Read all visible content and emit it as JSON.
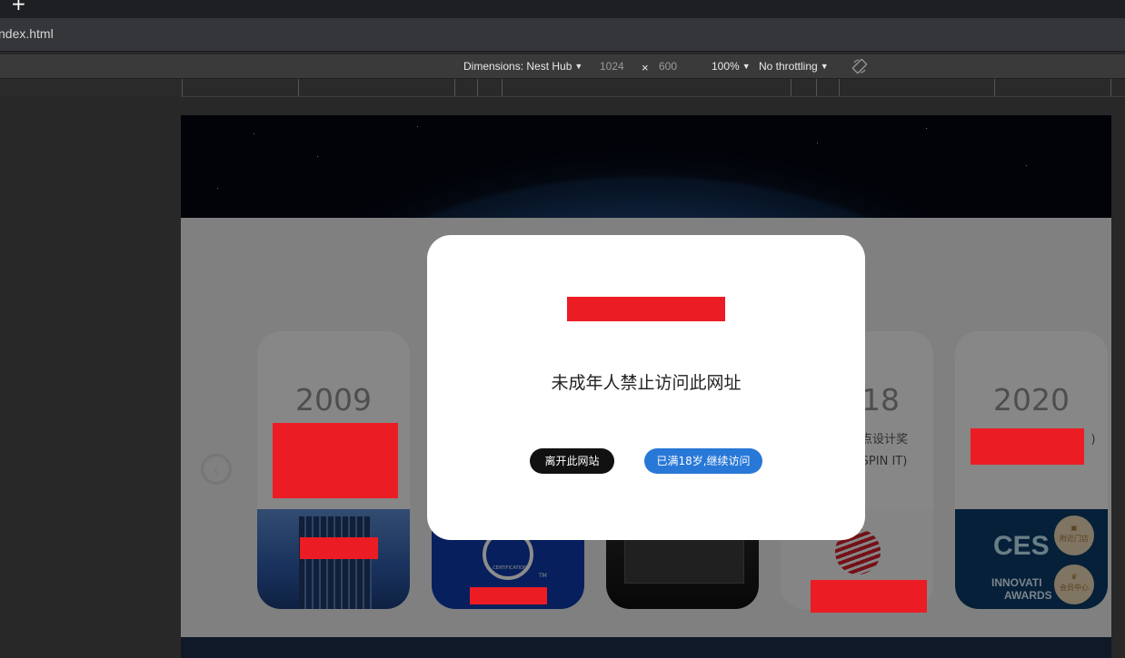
{
  "browser": {
    "new_tab_symbol": "+",
    "tab_title": "ndex.html"
  },
  "devtools": {
    "dimensions_label": "Dimensions: Nest Hub",
    "width": "1024",
    "times": "×",
    "height": "600",
    "zoom": "100%",
    "throttling": "No throttling",
    "rotate_icon": "rotate-icon"
  },
  "page": {
    "cards": [
      {
        "year": "2009",
        "text": ""
      },
      {
        "year": "",
        "text": ""
      },
      {
        "year": "",
        "text": ""
      },
      {
        "year": "18",
        "text": "点设计奖",
        "text2": "SPIN IT)"
      },
      {
        "year": "2020",
        "text": ")"
      }
    ],
    "cert_mark": "CERTIFICATION",
    "cert_tm": "TM",
    "ces_text": "CES",
    "ces_sub1": "INNOVATI",
    "ces_sub2": "AWARDS",
    "float_buttons": [
      {
        "icon": "store-icon",
        "label": "附近门店"
      },
      {
        "icon": "crown-icon",
        "label": "会员中心"
      }
    ],
    "prev_arrow": "‹"
  },
  "dialog": {
    "message": "未成年人禁止访问此网址",
    "leave_button": "离开此网站",
    "continue_button": "已满18岁,继续访问"
  },
  "colors": {
    "redacted": "#ec1c24",
    "continue_blue": "#2878d7"
  }
}
